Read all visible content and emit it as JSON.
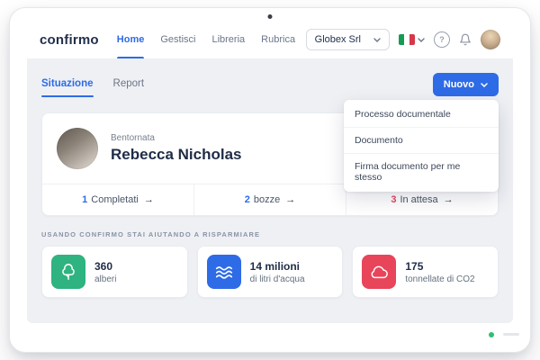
{
  "header": {
    "logo": "confirmo",
    "nav": [
      {
        "label": "Home"
      },
      {
        "label": "Gestisci"
      },
      {
        "label": "Libreria"
      },
      {
        "label": "Rubrica"
      }
    ],
    "org": "Globex Srl",
    "help": "?"
  },
  "tabs": [
    {
      "label": "Situazione"
    },
    {
      "label": "Report"
    }
  ],
  "actions": {
    "new_label": "Nuovo"
  },
  "menu": [
    "Processo documentale",
    "Documento",
    "Firma documento per me stesso"
  ],
  "welcome": {
    "greeting": "Bentornata",
    "name": "Rebecca Nicholas"
  },
  "stats": [
    {
      "value": "1",
      "label": "Completati",
      "arrow": "→"
    },
    {
      "value": "2",
      "label": "bozze",
      "arrow": "→"
    },
    {
      "value": "3",
      "label": "In attesa",
      "arrow": "→"
    }
  ],
  "savings": {
    "heading": "USANDO CONFIRMO STAI AIUTANDO A RISPARMIARE",
    "cards": [
      {
        "value": "360",
        "label": "alberi"
      },
      {
        "value": "14 milioni",
        "label": "di litri d'acqua"
      },
      {
        "value": "175",
        "label": "tonnellate di CO2"
      }
    ]
  },
  "colors": {
    "accent_blue": "#2e6be6",
    "green": "#2fb380",
    "red": "#e8445a",
    "navy": "#22304d"
  }
}
